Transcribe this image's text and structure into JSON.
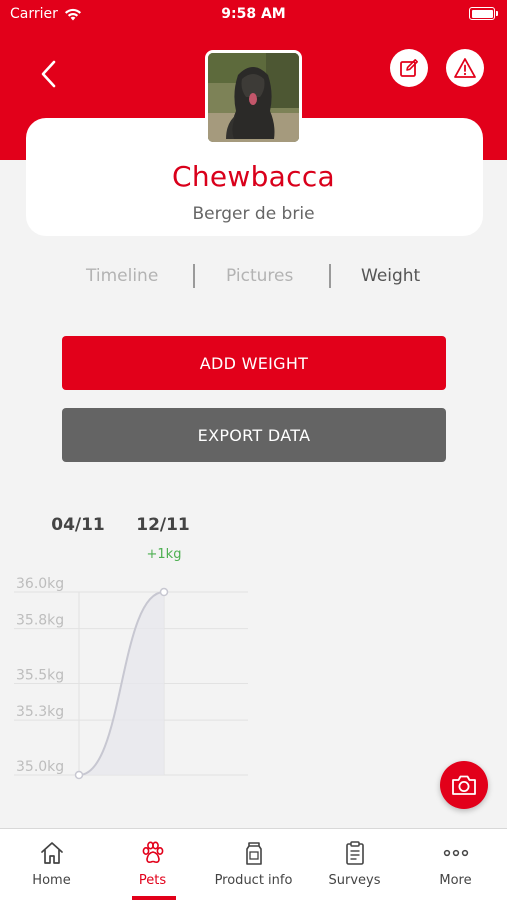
{
  "status_bar": {
    "carrier": "Carrier",
    "time": "9:58 AM"
  },
  "header": {
    "accent_color": "#e2001a",
    "back_icon": "chevron-left-icon",
    "edit_icon": "edit-icon",
    "alert_icon": "warning-icon"
  },
  "pet": {
    "name": "Chewbacca",
    "breed": "Berger de brie"
  },
  "tabs": [
    {
      "label": "Timeline",
      "active": false
    },
    {
      "label": "Pictures",
      "active": false
    },
    {
      "label": "Weight",
      "active": true
    }
  ],
  "actions": {
    "add_weight": "ADD WEIGHT",
    "export_data": "EXPORT DATA"
  },
  "chart_data": {
    "type": "area",
    "x": [
      "04/11",
      "12/11"
    ],
    "values": [
      35.0,
      36.0
    ],
    "delta_label": "+1kg",
    "y_ticks": [
      "36.0kg",
      "35.8kg",
      "35.5kg",
      "35.3kg",
      "35.0kg"
    ],
    "y_tick_values": [
      36.0,
      35.8,
      35.5,
      35.3,
      35.0
    ],
    "ylim": [
      35.0,
      36.0
    ],
    "grid": true
  },
  "fab": {
    "icon": "camera-icon"
  },
  "tabbar": [
    {
      "label": "Home",
      "icon": "home-icon",
      "active": false
    },
    {
      "label": "Pets",
      "icon": "paw-icon",
      "active": true
    },
    {
      "label": "Product info",
      "icon": "product-icon",
      "active": false
    },
    {
      "label": "Surveys",
      "icon": "clipboard-icon",
      "active": false
    },
    {
      "label": "More",
      "icon": "more-icon",
      "active": false
    }
  ]
}
